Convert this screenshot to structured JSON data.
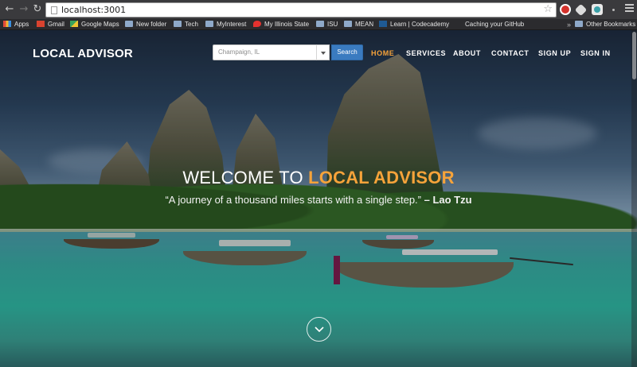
{
  "browser": {
    "url": "localhost:3001",
    "bookmarks": [
      {
        "label": "Apps",
        "icon": "apps-grid-icon"
      },
      {
        "label": "Gmail",
        "icon": "gmail-icon"
      },
      {
        "label": "Google Maps",
        "icon": "maps-icon"
      },
      {
        "label": "New folder",
        "icon": "folder-icon"
      },
      {
        "label": "Tech",
        "icon": "folder-icon"
      },
      {
        "label": "MyInterest",
        "icon": "folder-icon"
      },
      {
        "label": "My Illinois State",
        "icon": "pin-icon"
      },
      {
        "label": "ISU",
        "icon": "folder-icon"
      },
      {
        "label": "MEAN",
        "icon": "folder-icon"
      },
      {
        "label": "Learn | Codecademy",
        "icon": "codecademy-icon"
      },
      {
        "label": "Caching your GitHub",
        "icon": "none"
      }
    ],
    "overflow_label": "»",
    "other_bookmarks": "Other Bookmarks"
  },
  "site": {
    "brand": "LOCAL ADVISOR",
    "search": {
      "placeholder": "Champaign, IL",
      "button": "Search"
    },
    "nav": [
      {
        "label": "HOME",
        "active": true
      },
      {
        "label": "SERVICES",
        "active": false
      },
      {
        "label": "ABOUT",
        "active": false
      },
      {
        "label": "CONTACT",
        "active": false
      },
      {
        "label": "SIGN UP",
        "active": false
      },
      {
        "label": "SIGN IN",
        "active": false
      }
    ]
  },
  "hero": {
    "welcome": "WELCOME TO",
    "brand_highlight": "LOCAL ADVISOR",
    "quote": "“A journey of a thousand miles starts with a single step.”",
    "author": "– Lao Tzu"
  },
  "colors": {
    "accent": "#f6a33a",
    "search_button": "#3a7bc0"
  }
}
